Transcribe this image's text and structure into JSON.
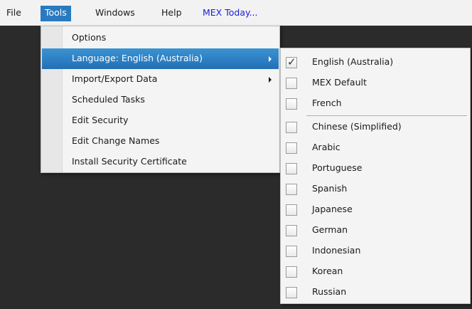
{
  "menubar": {
    "items": [
      "File",
      "Tools",
      "Windows",
      "Help",
      "MEX Today..."
    ],
    "active": "Tools"
  },
  "tools_menu": {
    "items": [
      {
        "label": "Options"
      },
      {
        "label": "Language: English (Australia)",
        "submenu": true
      },
      {
        "label": "Import/Export Data",
        "submenu": true
      },
      {
        "label": "Scheduled Tasks"
      },
      {
        "label": "Edit Security"
      },
      {
        "label": "Edit Change Names"
      },
      {
        "label": "Install Security Certificate"
      }
    ]
  },
  "language_menu": {
    "items": [
      {
        "label": "English (Australia)",
        "checked": true
      },
      {
        "label": "MEX Default",
        "checked": false
      },
      {
        "label": "French",
        "checked": false
      },
      {
        "label": "Chinese (Simplified)",
        "checked": false
      },
      {
        "label": "Arabic",
        "checked": false
      },
      {
        "label": "Portuguese",
        "checked": false
      },
      {
        "label": "Spanish",
        "checked": false
      },
      {
        "label": "Japanese",
        "checked": false
      },
      {
        "label": "German",
        "checked": false
      },
      {
        "label": "Indonesian",
        "checked": false
      },
      {
        "label": "Korean",
        "checked": false
      },
      {
        "label": "Russian",
        "checked": false
      }
    ],
    "check_glyph": "✓"
  },
  "colors": {
    "accent": "#2a7ac0",
    "link": "#1a1adc",
    "workspace": "#2b2b2b"
  }
}
